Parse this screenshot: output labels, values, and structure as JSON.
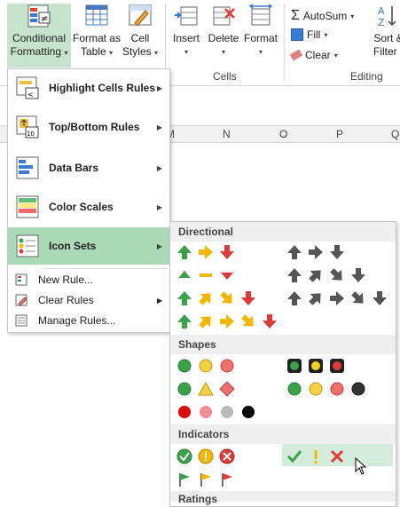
{
  "ribbon": {
    "conditional_formatting": {
      "line1": "Conditional",
      "line2": "Formatting"
    },
    "format_as_table": {
      "line1": "Format as",
      "line2": "Table"
    },
    "cell_styles": {
      "line1": "Cell",
      "line2": "Styles"
    },
    "insert": "Insert",
    "delete": "Delete",
    "format": "Format",
    "cells_group": "Cells",
    "autosum": "AutoSum",
    "fill": "Fill",
    "clear": "Clear",
    "sort_filter": {
      "line1": "Sort &",
      "line2": "Filter"
    },
    "editing_group": "Editing"
  },
  "columns": [
    "M",
    "N",
    "O",
    "P",
    "Q"
  ],
  "cf_menu": {
    "items": [
      {
        "label": "Highlight Cells Rules"
      },
      {
        "label": "Top/Bottom Rules"
      },
      {
        "label": "Data Bars"
      },
      {
        "label": "Color Scales"
      },
      {
        "label": "Icon Sets"
      }
    ],
    "small_items": [
      {
        "label": "New Rule..."
      },
      {
        "label": "Clear Rules"
      },
      {
        "label": "Manage Rules..."
      }
    ]
  },
  "icon_sets_menu": {
    "sections": [
      "Directional",
      "Shapes",
      "Indicators",
      "Ratings"
    ]
  },
  "colors": {
    "accent_selected": "#a9d9b5",
    "green": "#3aa34a",
    "yellow": "#f2b700",
    "red": "#e03b3b",
    "gray": "#555555"
  }
}
